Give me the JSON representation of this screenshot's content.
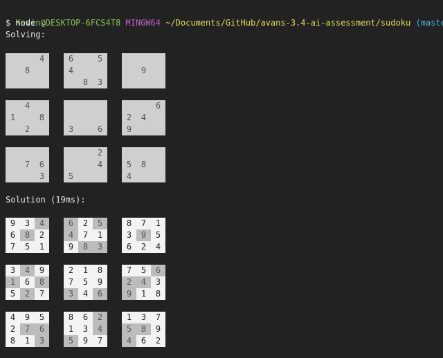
{
  "terminal": {
    "prompt": {
      "user_host": "Kevin@DESKTOP-6FCS4T8",
      "shell": "MINGW64",
      "path": "~/Documents/GitHub/avans-3.4-ai-assessment/sudoku",
      "branch": "(master)"
    },
    "command": "$ node .",
    "solving_label": "Solving:",
    "solution_label": "Solution (19ms):"
  },
  "puzzle": [
    [
      "",
      "",
      "",
      "",
      "",
      "",
      "",
      "",
      ""
    ],
    [
      "",
      "",
      "",
      "",
      "",
      "",
      "",
      "",
      ""
    ],
    [
      "",
      "",
      "",
      "",
      "",
      "",
      "",
      "",
      ""
    ],
    [
      "",
      "",
      "",
      "",
      "",
      "",
      "",
      "",
      ""
    ],
    [
      "",
      "",
      "",
      "",
      "",
      "",
      "",
      "",
      ""
    ],
    [
      "",
      "",
      "",
      "",
      "",
      "",
      "",
      "",
      ""
    ],
    [
      "",
      "",
      "",
      "",
      "",
      "",
      "",
      "",
      ""
    ],
    [
      "",
      "",
      "",
      "",
      "",
      "",
      "",
      "",
      ""
    ],
    [
      "",
      "",
      "",
      "",
      "",
      "",
      "",
      "",
      ""
    ]
  ],
  "puzzle_rows": [
    [
      "",
      "",
      "4",
      "6",
      "",
      "5",
      "",
      "",
      ""
    ],
    [
      "",
      "8",
      "",
      "4",
      "",
      "",
      "",
      "9",
      ""
    ],
    [
      "",
      "",
      "",
      "",
      "8",
      "3",
      "",
      "",
      ""
    ],
    [
      "",
      "4",
      "",
      "",
      "",
      "",
      "",
      "",
      "6"
    ],
    [
      "1",
      "",
      "8",
      "",
      "",
      "",
      "2",
      "4",
      ""
    ],
    [
      "",
      "2",
      "",
      "3",
      "",
      "6",
      "9",
      "",
      ""
    ],
    [
      "",
      "",
      "",
      "",
      "",
      "2",
      "",
      "",
      ""
    ],
    [
      "",
      "7",
      "6",
      "",
      "",
      "4",
      "5",
      "8",
      ""
    ],
    [
      "",
      "",
      "3",
      "5",
      "",
      "",
      "4",
      "",
      ""
    ]
  ],
  "solution_rows": [
    [
      "9",
      "3",
      "4",
      "6",
      "2",
      "5",
      "8",
      "7",
      "1"
    ],
    [
      "6",
      "8",
      "2",
      "4",
      "7",
      "1",
      "3",
      "9",
      "5"
    ],
    [
      "7",
      "5",
      "1",
      "9",
      "8",
      "3",
      "6",
      "2",
      "4"
    ],
    [
      "3",
      "4",
      "9",
      "2",
      "1",
      "8",
      "7",
      "5",
      "6"
    ],
    [
      "1",
      "6",
      "8",
      "7",
      "5",
      "9",
      "2",
      "4",
      "3"
    ],
    [
      "5",
      "2",
      "7",
      "3",
      "4",
      "6",
      "9",
      "1",
      "8"
    ],
    [
      "4",
      "9",
      "5",
      "8",
      "6",
      "2",
      "1",
      "3",
      "7"
    ],
    [
      "2",
      "7",
      "6",
      "1",
      "3",
      "4",
      "5",
      "8",
      "9"
    ],
    [
      "8",
      "1",
      "3",
      "5",
      "9",
      "7",
      "4",
      "6",
      "2"
    ]
  ],
  "colors": {
    "background": "#222222",
    "puzzle_block": "#cfcfcf",
    "given_cell": "#bcbcbc",
    "solved_cell": "#f3f3f3",
    "user_host": "#88c057",
    "shell": "#c25ec9",
    "path": "#e2d85c",
    "branch": "#4ab0e0"
  }
}
